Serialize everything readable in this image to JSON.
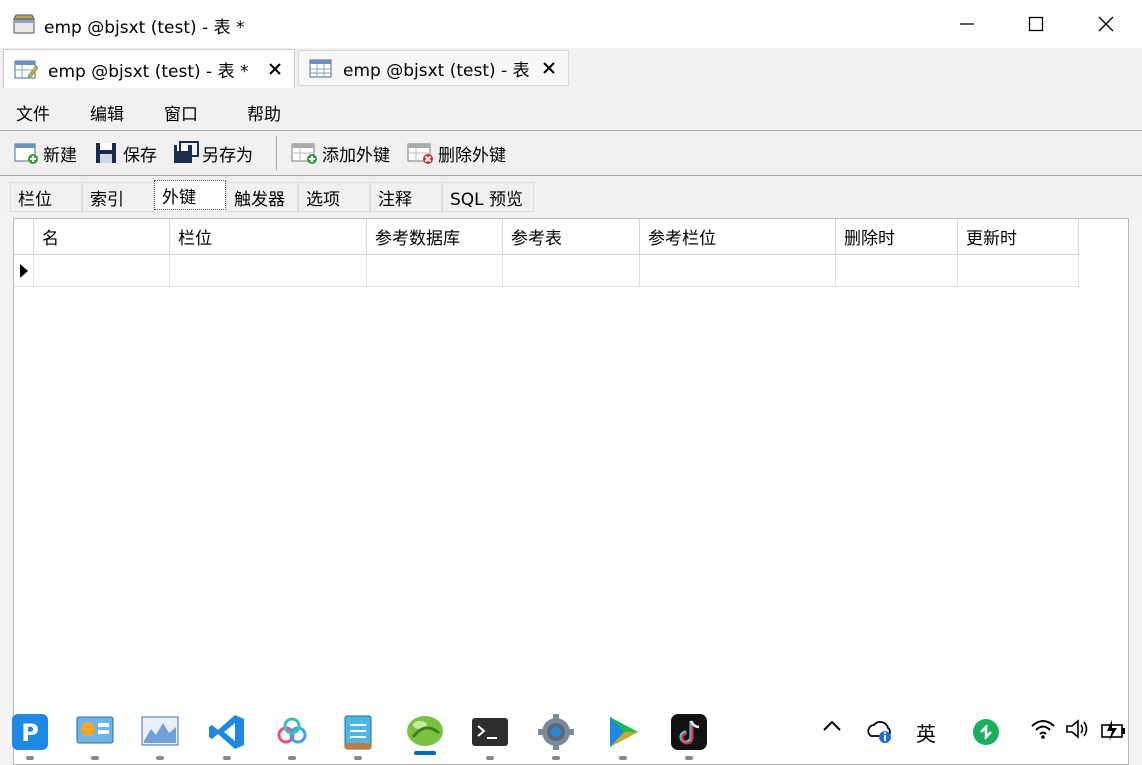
{
  "window": {
    "title": "emp @bjsxt (test) - 表 *"
  },
  "doc_tabs": [
    {
      "label": "emp @bjsxt (test) - 表 *",
      "active": true
    },
    {
      "label": "emp @bjsxt (test) - 表",
      "active": false
    }
  ],
  "menu": {
    "file": "文件",
    "edit": "编辑",
    "window": "窗口",
    "help": "帮助"
  },
  "toolbar": {
    "new": "新建",
    "save": "保存",
    "save_as": "另存为",
    "add_fk": "添加外键",
    "delete_fk": "删除外键"
  },
  "subtabs": [
    "栏位",
    "索引",
    "外键",
    "触发器",
    "选项",
    "注释",
    "SQL 预览"
  ],
  "active_subtab": "外键",
  "grid": {
    "columns": [
      "名",
      "栏位",
      "参考数据库",
      "参考表",
      "参考栏位",
      "删除时",
      "更新时"
    ]
  },
  "tray": {
    "ime": "英"
  },
  "colors": {
    "accent": "#0067c0",
    "titlebar": "#ffffff"
  }
}
